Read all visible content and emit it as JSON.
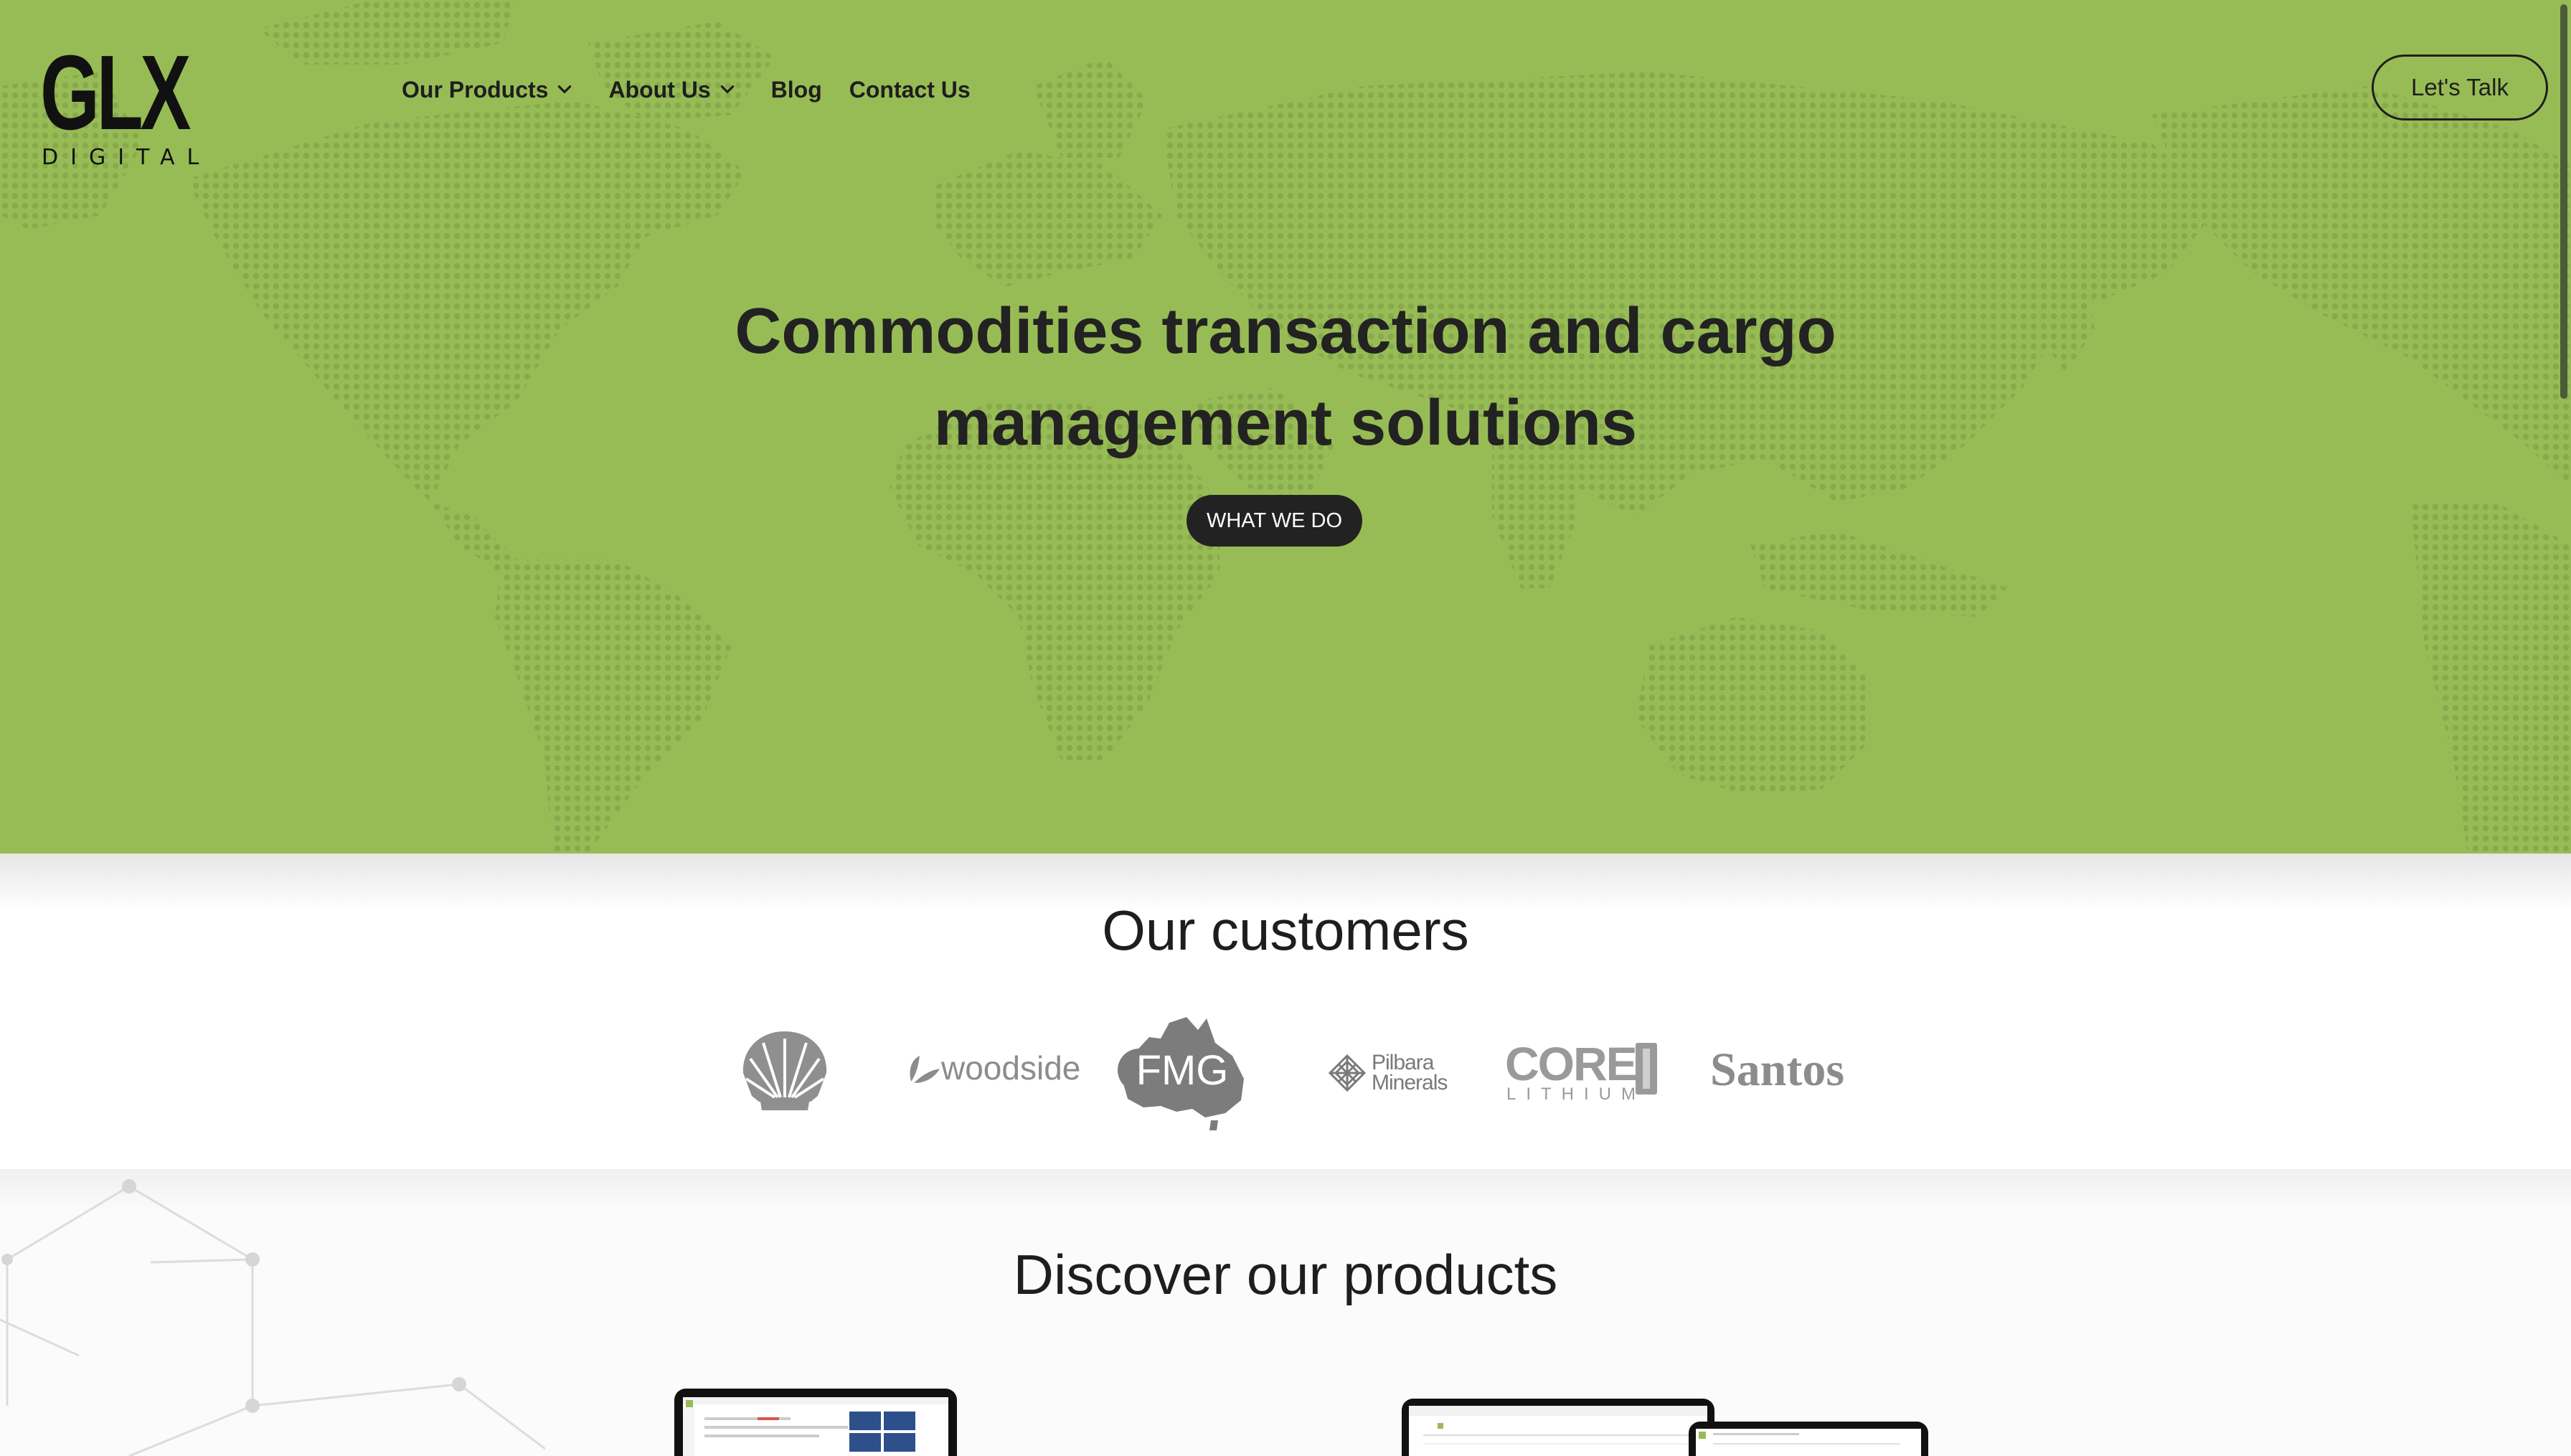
{
  "brand": {
    "logo_main": "GLX",
    "logo_sub": "DIGITAL"
  },
  "nav": {
    "items": [
      {
        "label": "Our Products",
        "has_dropdown": true
      },
      {
        "label": "About Us",
        "has_dropdown": true
      },
      {
        "label": "Blog",
        "has_dropdown": false
      },
      {
        "label": "Contact Us",
        "has_dropdown": false
      }
    ],
    "cta_label": "Let's Talk"
  },
  "hero": {
    "title": "Commodities transaction and cargo management solutions",
    "button_label": "WHAT WE DO",
    "background_color": "#98bc55",
    "map_dot_color": "#8aab4d"
  },
  "customers": {
    "title": "Our customers",
    "logos": [
      {
        "name": "Shell",
        "text": ""
      },
      {
        "name": "Woodside",
        "text": "woodside"
      },
      {
        "name": "FMG",
        "text": "FMG"
      },
      {
        "name": "Pilbara Minerals",
        "text_line1": "Pilbara",
        "text_line2": "Minerals"
      },
      {
        "name": "Core Lithium",
        "text_line1": "CORE",
        "text_line2": "LITHIUM"
      },
      {
        "name": "Santos",
        "text": "Santos"
      }
    ]
  },
  "products": {
    "title": "Discover our products"
  },
  "colors": {
    "dark": "#222222",
    "logo_grey": "#8c8c8c",
    "accent_green": "#98bc55",
    "dashboard_blue": "#2d4f8a"
  }
}
